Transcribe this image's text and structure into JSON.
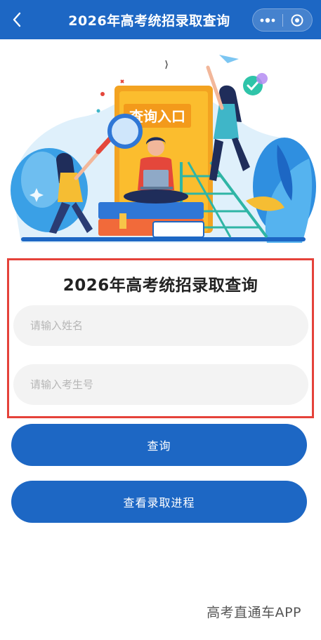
{
  "header": {
    "title": "2026年高考统招录取查询",
    "back_icon": "chevron-left-icon",
    "more_icon": "more-dots-icon",
    "close_icon": "target-circle-icon",
    "bar_color": "#1d67c4"
  },
  "hero": {
    "sign_text": "查询入口"
  },
  "form": {
    "title": "2026年高考统招录取查询",
    "name_placeholder": "请输入姓名",
    "id_placeholder": "请输入考生号",
    "highlight_color": "#e5423a"
  },
  "buttons": {
    "query_label": "查询",
    "progress_label": "查看录取进程",
    "color": "#1d67c4"
  },
  "footer": {
    "watermark": "高考直通车APP"
  }
}
